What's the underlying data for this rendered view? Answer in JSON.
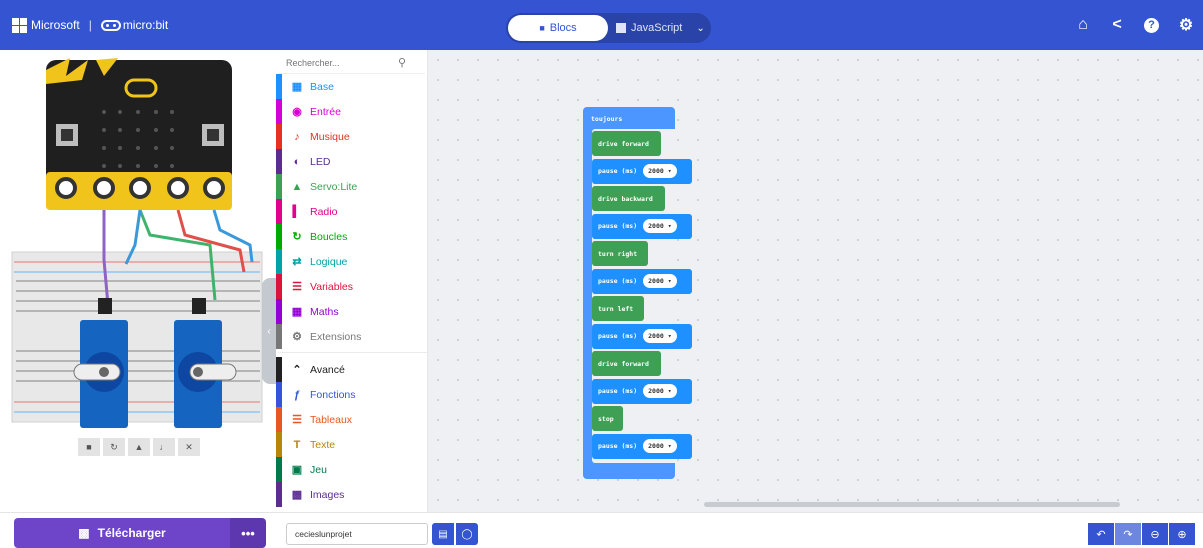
{
  "header": {
    "brand_ms": "Microsoft",
    "brand_mb": "micro:bit",
    "mode_blocks": "Blocs",
    "mode_js": "JavaScript",
    "icons": [
      "home-icon",
      "share-icon",
      "help-icon",
      "settings-icon"
    ]
  },
  "toolbox": {
    "search_placeholder": "Rechercher...",
    "categories": [
      {
        "label": "Base",
        "color": "#1e90ff"
      },
      {
        "label": "Entrée",
        "color": "#d400d4"
      },
      {
        "label": "Musique",
        "color": "#e63022"
      },
      {
        "label": "LED",
        "color": "#5c2d91"
      },
      {
        "label": "Servo:Lite",
        "color": "#3ea055"
      },
      {
        "label": "Radio",
        "color": "#e3008c"
      },
      {
        "label": "Boucles",
        "color": "#00aa00"
      },
      {
        "label": "Logique",
        "color": "#00a4a6"
      },
      {
        "label": "Variables",
        "color": "#dc143c"
      },
      {
        "label": "Maths",
        "color": "#9400d3"
      },
      {
        "label": "Extensions",
        "color": "#777777"
      }
    ],
    "advanced": [
      {
        "label": "Avancé",
        "color": "#212121"
      },
      {
        "label": "Fonctions",
        "color": "#3455db"
      },
      {
        "label": "Tableaux",
        "color": "#e65722"
      },
      {
        "label": "Texte",
        "color": "#b8860b"
      },
      {
        "label": "Jeu",
        "color": "#007a4b"
      },
      {
        "label": "Images",
        "color": "#5c2d91"
      }
    ]
  },
  "workspace": {
    "forever_label": "toujours",
    "blocks": [
      {
        "kind": "green",
        "label": "drive forward"
      },
      {
        "kind": "blue",
        "label": "pause (ms)",
        "value": "2000 ▾"
      },
      {
        "kind": "green",
        "label": "drive backward"
      },
      {
        "kind": "blue",
        "label": "pause (ms)",
        "value": "2000 ▾"
      },
      {
        "kind": "green",
        "label": "turn right"
      },
      {
        "kind": "blue",
        "label": "pause (ms)",
        "value": "2000 ▾"
      },
      {
        "kind": "green",
        "label": "turn left"
      },
      {
        "kind": "blue",
        "label": "pause (ms)",
        "value": "2000 ▾"
      },
      {
        "kind": "green",
        "label": "drive forward"
      },
      {
        "kind": "blue",
        "label": "pause (ms)",
        "value": "2000 ▾"
      },
      {
        "kind": "green",
        "label": "stop"
      },
      {
        "kind": "blue",
        "label": "pause (ms)",
        "value": "2000 ▾"
      }
    ]
  },
  "footer": {
    "download_label": "Télécharger",
    "more_label": "•••",
    "project_name": "cecieslunprojet"
  }
}
